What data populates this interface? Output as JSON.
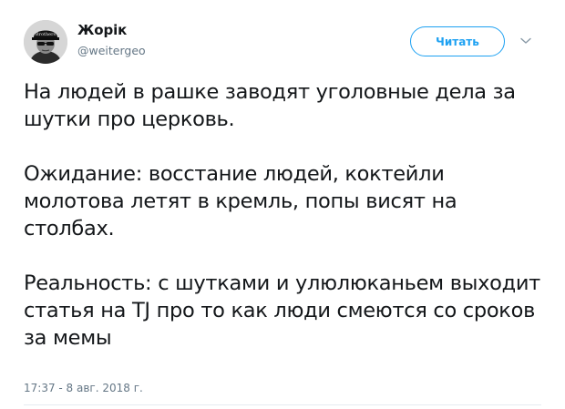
{
  "author": {
    "name": "Жорік",
    "handle": "@weitergeo"
  },
  "follow_button": {
    "label": "Читать"
  },
  "icons": {
    "avatar": "avatar-image",
    "more": "chevron-down-icon"
  },
  "tweet": {
    "paragraphs": [
      "На людей в рашке заводят уголовные дела за шутки про церковь.",
      "Ожидание: восстание людей, коктейли молотова летят в кремль, попы висят на столбах.",
      "Реальность: с шутками и улюлюканьем выходит статья на TJ про то как люди смеются со сроков за мемы"
    ],
    "timestamp": "17:37 - 8 авг. 2018 г."
  },
  "colors": {
    "accent": "#1da1f2",
    "text": "#14171a",
    "secondary": "#657786",
    "divider": "#e6ecf0"
  }
}
